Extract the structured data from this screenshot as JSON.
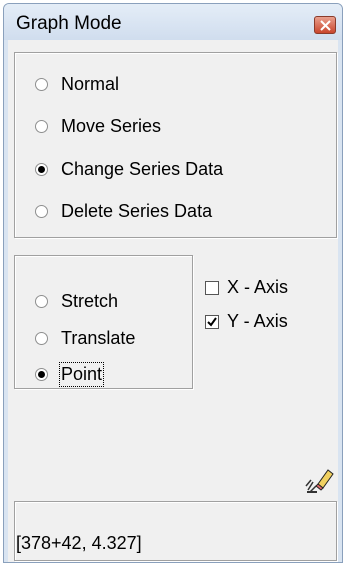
{
  "window": {
    "title": "Graph Mode"
  },
  "mode_group": {
    "options": [
      {
        "label": "Normal",
        "checked": false
      },
      {
        "label": "Move Series",
        "checked": false
      },
      {
        "label": "Change Series Data",
        "checked": true
      },
      {
        "label": "Delete Series Data",
        "checked": false
      }
    ]
  },
  "transform_group": {
    "options": [
      {
        "label": "Stretch",
        "checked": false
      },
      {
        "label": "Translate",
        "checked": false
      },
      {
        "label": "Point",
        "checked": true
      }
    ]
  },
  "axes": {
    "x_axis": {
      "label": "X - Axis",
      "checked": false
    },
    "y_axis": {
      "label": "Y - Axis",
      "checked": true
    }
  },
  "toolbar": {
    "eraser_icon": "eraser-icon"
  },
  "status": {
    "coordinates": "[378+42, 4.327]"
  }
}
